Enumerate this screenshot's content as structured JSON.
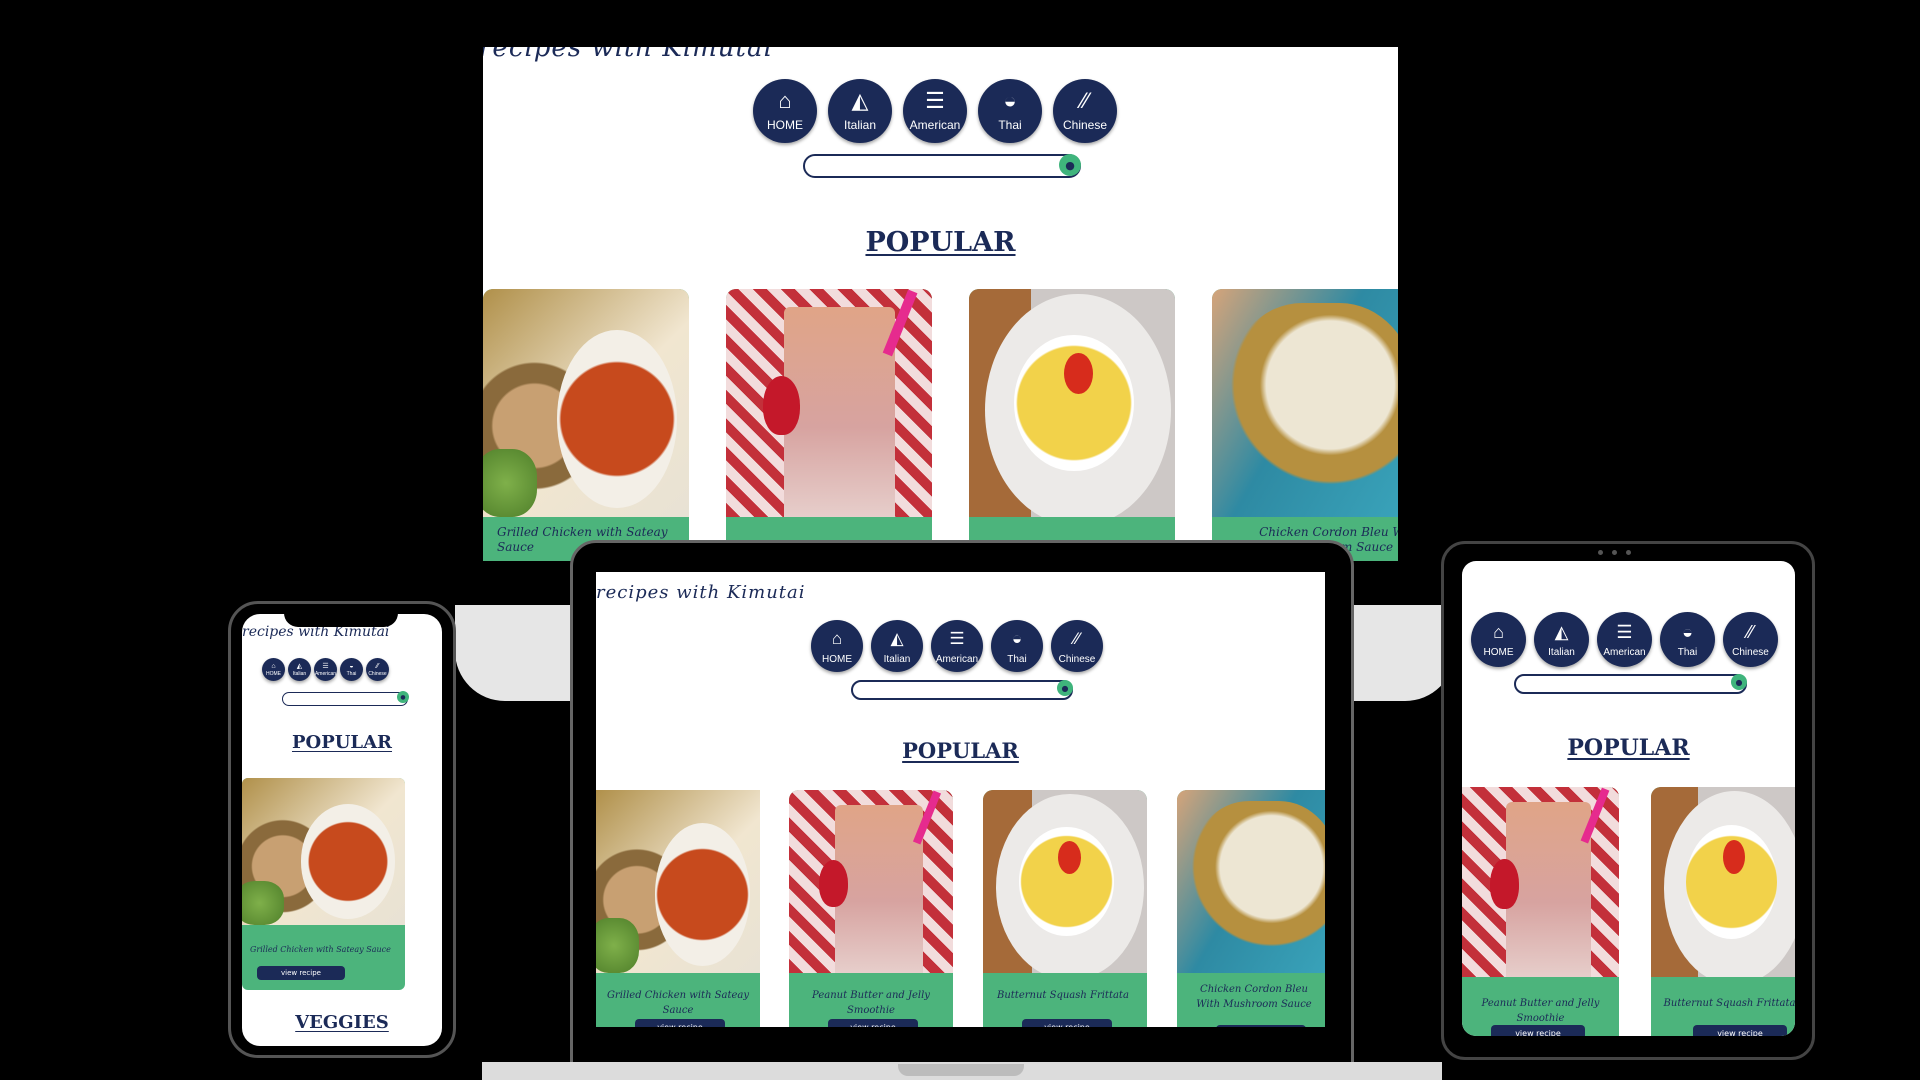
{
  "site": {
    "brand": "recipes with Kimutai",
    "nav": [
      {
        "label": "HOME",
        "icon": "home-icon",
        "glyph": "⌂"
      },
      {
        "label": "Italian",
        "icon": "pizza-icon",
        "glyph": "◭"
      },
      {
        "label": "American",
        "icon": "burger-icon",
        "glyph": "☰"
      },
      {
        "label": "Thai",
        "icon": "noodle-bowl-icon",
        "glyph": "◒"
      },
      {
        "label": "Chinese",
        "icon": "chopsticks-icon",
        "glyph": "⁄⁄"
      }
    ],
    "search": {
      "placeholder": "",
      "button_icon": "search-icon"
    },
    "popular_heading": "POPULAR",
    "veggies_heading": "VEGGIES",
    "view_label": "view recipe",
    "recipes": [
      "Grilled Chicken with Sateay Sauce",
      "Peanut Butter and Jelly Smoothie",
      "Butternut Squash Frittata",
      "Chicken Cordon Bleu With Mushroom Sauce"
    ]
  },
  "colors": {
    "navy": "#1b2a57",
    "green": "#4cb47c",
    "search_green": "#3fb47c"
  }
}
